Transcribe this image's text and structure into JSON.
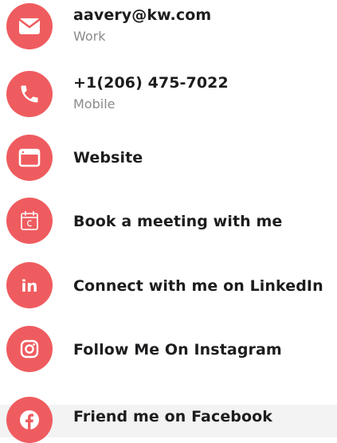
{
  "accent_color": "#ef5c5f",
  "contacts": [
    {
      "icon": "email-icon",
      "primary": "aavery@kw.com",
      "secondary": "Work"
    },
    {
      "icon": "phone-icon",
      "primary": "+1(206) 475-7022",
      "secondary": "Mobile"
    },
    {
      "icon": "website-icon",
      "primary": "Website"
    },
    {
      "icon": "calendar-icon",
      "primary": "Book a meeting with me"
    },
    {
      "icon": "linkedin-icon",
      "primary": "Connect with me on LinkedIn"
    },
    {
      "icon": "instagram-icon",
      "primary": "Follow Me On Instagram"
    },
    {
      "icon": "facebook-icon",
      "primary": "Friend me on Facebook"
    }
  ]
}
